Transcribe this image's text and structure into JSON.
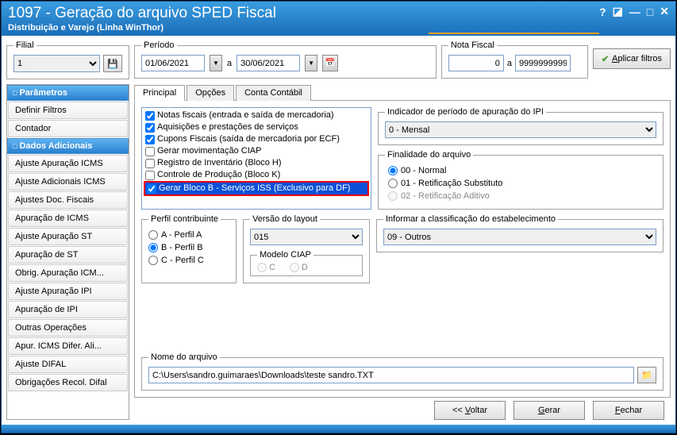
{
  "title": "1097 - Geração do arquivo SPED Fiscal",
  "subtitle": "Distribuição e Varejo (Linha WinThor)",
  "filial": {
    "label": "Filial",
    "value": "1"
  },
  "periodo": {
    "label": "Período",
    "from": "01/06/2021",
    "sep": "a",
    "to": "30/06/2021"
  },
  "notafiscal": {
    "label": "Nota Fiscal",
    "from": "0",
    "sep": "a",
    "to": "9999999999"
  },
  "apply": "Aplicar filtros",
  "sidebar": {
    "group1": "Parâmetros",
    "items1": [
      "Definir Filtros",
      "Contador"
    ],
    "group2": "Dados Adicionais",
    "items2": [
      "Ajuste Apuração ICMS",
      "Ajuste Adicionais ICMS",
      "Ajustes Doc. Fiscais",
      "Apuração de ICMS",
      "Ajuste Apuração ST",
      "Apuração de ST",
      "Obrig. Apuração ICM...",
      "Ajuste Apuração IPI",
      "Apuração de IPI",
      "Outras Operações",
      "Apur. ICMS Difer. Ali...",
      "Ajuste DIFAL",
      "Obrigações Recol. Difal"
    ]
  },
  "tabs": [
    "Principal",
    "Opções",
    "Conta Contábil"
  ],
  "checks": [
    {
      "c": true,
      "t": "Notas fiscais (entrada e saída de mercadoria)"
    },
    {
      "c": true,
      "t": "Aquisições e prestações de serviços"
    },
    {
      "c": true,
      "t": "Cupons Fiscais (saída de mercadoria por ECF)"
    },
    {
      "c": false,
      "t": "Gerar movimentação CIAP"
    },
    {
      "c": false,
      "t": "Registro de Inventário (Bloco H)"
    },
    {
      "c": false,
      "t": "Controle de Produção (Bloco K)"
    },
    {
      "c": true,
      "t": "Gerar Bloco B - Serviços ISS (Exclusivo para DF)",
      "hl": true
    }
  ],
  "ipi": {
    "legend": "Indicador de período de apuração do IPI",
    "value": "0 - Mensal"
  },
  "finalidade": {
    "legend": "Finalidade do arquivo",
    "opts": [
      "00 - Normal",
      "01 - Retificação Substituto",
      "02 - Retificação Aditivo"
    ]
  },
  "class": {
    "legend": "Informar a classificação do estabelecimento",
    "value": "09 - Outros"
  },
  "perfil": {
    "legend": "Perfil contribuinte",
    "opts": [
      "A - Perfil A",
      "B - Perfil B",
      "C - Perfil C"
    ]
  },
  "versao": {
    "legend": "Versão do layout",
    "value": "015"
  },
  "ciap": {
    "legend": "Modelo CIAP",
    "opts": [
      "C",
      "D"
    ]
  },
  "nome": {
    "legend": "Nome do arquivo",
    "value": "C:\\Users\\sandro.guimaraes\\Downloads\\teste sandro.TXT"
  },
  "buttons": {
    "back": "<< Voltar",
    "gen": "Gerar",
    "close": "Fechar"
  }
}
